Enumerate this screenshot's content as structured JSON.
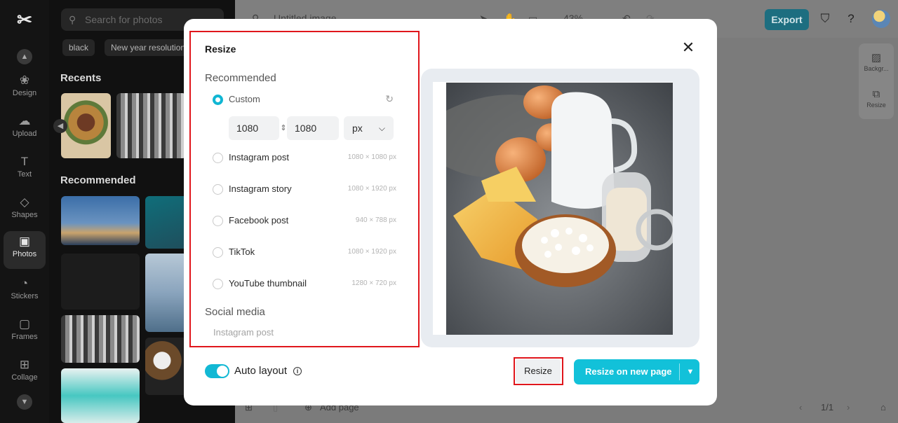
{
  "rail": {
    "items": [
      {
        "label": "Design",
        "icon": "design-icon"
      },
      {
        "label": "Upload",
        "icon": "upload-icon"
      },
      {
        "label": "Text",
        "icon": "text-icon"
      },
      {
        "label": "Shapes",
        "icon": "shapes-icon"
      },
      {
        "label": "Photos",
        "icon": "photos-icon"
      },
      {
        "label": "Stickers",
        "icon": "stickers-icon"
      },
      {
        "label": "Frames",
        "icon": "frames-icon"
      },
      {
        "label": "Collage",
        "icon": "collage-icon"
      }
    ]
  },
  "panel": {
    "search_placeholder": "Search for photos",
    "chips": [
      "black",
      "New year resolution"
    ],
    "recents_heading": "Recents",
    "recommended_heading": "Recommended"
  },
  "topbar": {
    "doc_title": "Untitled image",
    "zoom": "43%",
    "export_label": "Export"
  },
  "right_tools": {
    "background_label": "Backgr...",
    "resize_label": "Resize"
  },
  "bottombar": {
    "add_page_label": "Add page",
    "page_counter": "1/1"
  },
  "modal": {
    "title": "Resize",
    "recommended_heading": "Recommended",
    "custom": {
      "label": "Custom",
      "width": "1080",
      "height": "1080",
      "unit": "px",
      "selected": true
    },
    "presets": [
      {
        "label": "Instagram post",
        "size": "1080 × 1080 px"
      },
      {
        "label": "Instagram story",
        "size": "1080 × 1920 px"
      },
      {
        "label": "Facebook post",
        "size": "940 × 788 px"
      },
      {
        "label": "TikTok",
        "size": "1080 × 1920 px"
      },
      {
        "label": "YouTube thumbnail",
        "size": "1280 × 720 px"
      }
    ],
    "social_heading": "Social media",
    "social_first_item": "Instagram post",
    "auto_layout_label": "Auto layout",
    "auto_layout_on": true,
    "resize_button": "Resize",
    "resize_new_page_button": "Resize on new page"
  },
  "colors": {
    "accent": "#12c1d9",
    "highlight_border": "#e0161c",
    "export_button": "#1d6e80"
  }
}
